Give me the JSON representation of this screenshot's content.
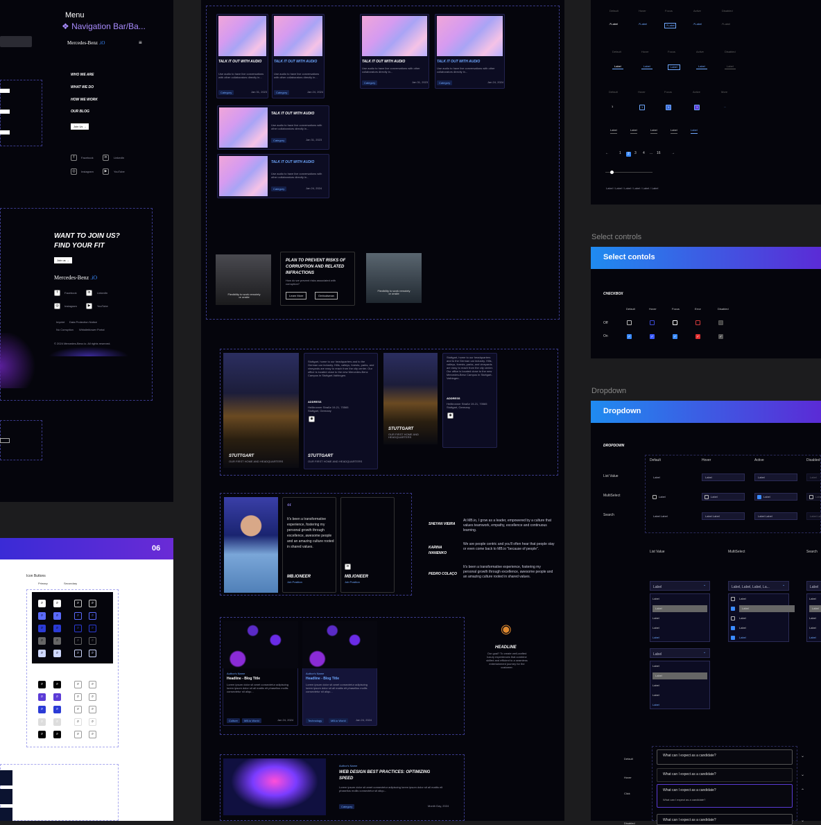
{
  "nav": {
    "menu_title": "Menu",
    "component_title": "❖ Navigation Bar/Ba...",
    "brand": "Mercedes-Benz",
    "brand_suffix": ".iO",
    "links": [
      "WHO WE ARE",
      "WHAT WE DO",
      "HOW WE WORK",
      "OUR BLOG"
    ],
    "join": "Join Us →",
    "socials": [
      "Facebook",
      "LinkedIn",
      "Instagram",
      "YouTube"
    ]
  },
  "footer": {
    "heading_1": "WANT TO JOIN US?",
    "heading_2": "FIND YOUR FIT",
    "join": "Join us →",
    "brand": "Mercedes-Benz",
    "brand_suffix": ".iO",
    "socials": [
      "Facebook",
      "LinkedIn",
      "Instagram",
      "YouTube"
    ],
    "legal": [
      "Imprint",
      "Data Protection Notice",
      "No Corruption",
      "Whistleblower Portal"
    ],
    "copyright": "© 2024 Mercedes-Benz.io. All rights reserved."
  },
  "icon_buttons": {
    "badge": "06",
    "title": "Icon Buttons",
    "primary": "Primary",
    "secondary": "Secondary"
  },
  "cards": {
    "title": "TALK IT OUT WITH AUDIO",
    "body": "Use audio to have live conversations with other collaborators directly in...",
    "category": "Category",
    "date_1": "Jan 31, 2023",
    "date_2": "Jan 24, 2024",
    "date_3": "Jan 31, 2023",
    "date_4": "Jan 24, 2024"
  },
  "promo": {
    "flex": "Flexibility to work remotely or onsite",
    "plan_title": "PLAN TO PREVENT RISKS OF CORRUPTION AND RELATED INFRACTIONS",
    "plan_body": "How do we prevent risks associated with corruption?",
    "learn": "Learn More",
    "ombudsman": "Ombudsman"
  },
  "office": {
    "city": "STUTTGART",
    "sub": "OUR FIRST HOME AND HEADQUARTERS",
    "address_label": "ADDRESS",
    "address": "Heilbronner Straße 19-21, 70565 Stuttgart, Germany",
    "body": "Stuttgart, home to our headquarters and to the German car industry. Hills, valleys, forests, parks, and vineyards are easy to reach from the city center. Our office is located close to the new Mercedes-Benz Campus in Stuttgart-Vaihingen."
  },
  "testimonial": {
    "quote": "It's been a transformative experience, fostering my personal growth through excellence, awesome people and an amazing culture rooted in shared values.",
    "name": "MB.IONEER",
    "role": "Job Position",
    "people": [
      {
        "name": "SHEYAN VIEIRA",
        "text": "At MB.io, I grow as a leader, empowered by a culture that values teamwork, empathy, excellence and continuous learning."
      },
      {
        "name": "KARINA IVANENKO",
        "text": "We are people centric and you'll often hear that people stay or even come back to MB.io \"because of people\"."
      },
      {
        "name": "PEDRO COLAÇO",
        "text": "It's been a transformative experience, fostering my personal growth through excellence, awesome people and an amazing culture rooted in shared values."
      }
    ]
  },
  "blog": {
    "author": "Author's Name",
    "title": "Headline - Blog Title",
    "body": "Lorem ipsum dolor sit amet consectetur adipiscing lorem ipsum dolor sit all mattis elt phasellus mollis consectetur sit aliqu...",
    "tags_1": [
      "Culture",
      "MB.io World"
    ],
    "tags_2": [
      "Technology",
      "MB.io World"
    ],
    "date": "Jan 24, 2024",
    "headline": "HEADLINE",
    "headline_body": "Our goal? To create well-crafted luxury experiences that combine skilled and efficient to a seamless entertainment journey for the customer."
  },
  "article": {
    "author": "Author's Name",
    "title": "WEB DESIGN BEST PRACTICES: OPTIMIZING SPEED",
    "body": "Lorem ipsum dolor sit amet consectetur adipiscing lorem ipsum dolor sit all mattis elt phasellus mollis consectetur sit aliqu...",
    "category": "Category",
    "date": "Month Day, 2024"
  },
  "states": {
    "labels": [
      "Default",
      "Hover",
      "Focus",
      "Active",
      "Disabled"
    ],
    "label": "Label",
    "pager_labels": [
      "Default",
      "Hover",
      "Focus",
      "Active",
      "More"
    ],
    "pages": [
      "←",
      "1",
      "2",
      "3",
      "4",
      "...",
      "16",
      "→"
    ],
    "breadcrumb": "Label / Label / Label / Label / Label / Label"
  },
  "select": {
    "section": "Select controls",
    "bar": "Select contols",
    "checkbox": "CHECKBOX",
    "states": [
      "Default",
      "Hover",
      "Focus",
      "Error",
      "Disabled"
    ],
    "off": "Off",
    "on": "On"
  },
  "dropdown": {
    "section": "Dropdown",
    "bar": "Dropdown",
    "title": "DROPDOWN",
    "states": [
      "Default",
      "Hover",
      "Active",
      "Disabled"
    ],
    "rows": [
      "List Value",
      "MultiSelect",
      "Search"
    ],
    "cols": [
      "List Value",
      "MultiSelect",
      "Search"
    ],
    "label": "Label",
    "multi": "Label, Label, Label, La...",
    "accordion_states": [
      "Default",
      "Hover",
      "Click",
      "Disabled"
    ],
    "question": "What can I expect as a candidate?"
  },
  "colors": {
    "accent": "#5b2bd6",
    "blue": "#1f8bf0",
    "bg": "#05050c"
  }
}
